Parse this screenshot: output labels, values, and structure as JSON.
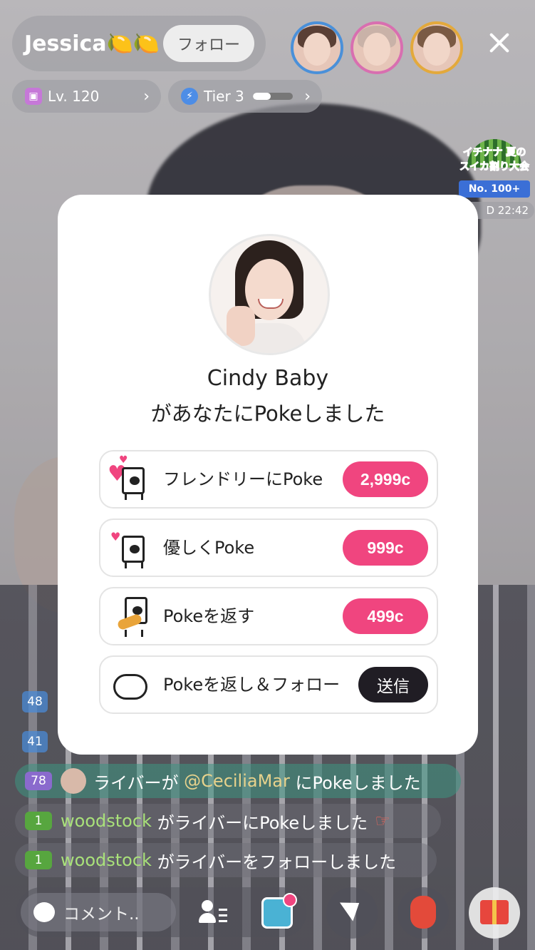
{
  "host": {
    "name": "Jessica🍋🍋",
    "follow_label": "フォロー",
    "level_label": "Lv. 120",
    "tier_label": "Tier 3",
    "tier_progress": 0.45
  },
  "icons": {
    "close": "close-icon",
    "level": "level-badge-icon",
    "tier": "lightning-icon",
    "chevron": "chevron-right-icon"
  },
  "event": {
    "title": "イチナナ 夏のスイカ割り大会",
    "rank": "No. 100+",
    "countdown": "D 22:42"
  },
  "modal": {
    "sender_name": "Cindy Baby",
    "message": "があなたにPokeしました",
    "options": [
      {
        "label": "フレンドリーにPoke",
        "price": "2,999c"
      },
      {
        "label": "優しくPoke",
        "price": "999c"
      },
      {
        "label": "Pokeを返す",
        "price": "499c"
      },
      {
        "label": "Pokeを返し＆フォロー",
        "action": "送信"
      }
    ]
  },
  "chat": {
    "hidden_levels": [
      "48",
      "41"
    ],
    "messages": [
      {
        "level": "78",
        "prefix": "ライバーが",
        "user": "@CeciliaMar",
        "suffix": "にPokeしました"
      },
      {
        "level": "1",
        "user": "woodstock",
        "suffix": "がライバーにPokeしました"
      },
      {
        "level": "1",
        "user": "woodstock",
        "suffix": "がライバーをフォローしました"
      }
    ]
  },
  "bottom": {
    "comment_placeholder": "コメント.."
  },
  "colors": {
    "accent_pink": "#f0457f",
    "send_dark": "#201d24",
    "username_green": "#a9e17a"
  }
}
